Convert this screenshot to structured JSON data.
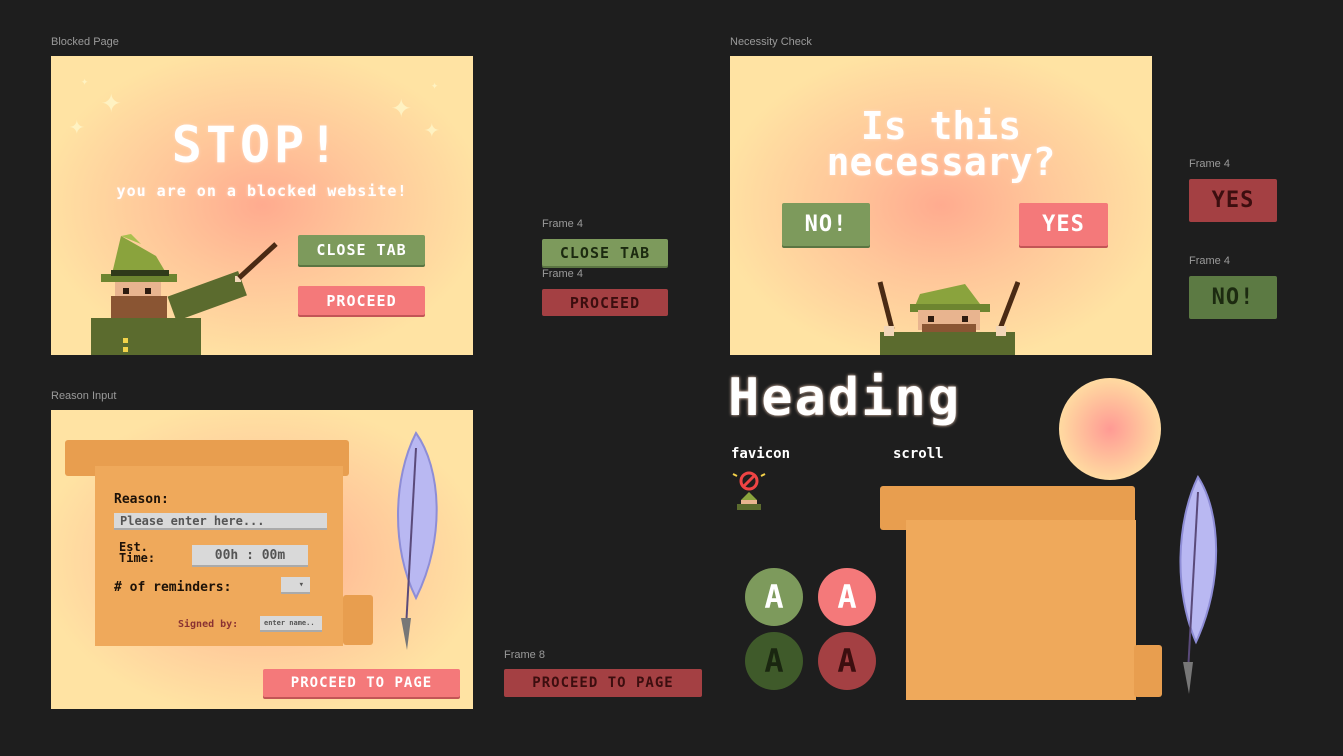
{
  "frames": {
    "blocked": {
      "label": "Blocked Page",
      "title": "STOP!",
      "subtitle": "you are on a blocked website!",
      "close_tab": "CLOSE TAB",
      "proceed": "PROCEED"
    },
    "necessity": {
      "label": "Necessity Check",
      "title_line1": "Is this",
      "title_line2": "necessary?",
      "no": "NO!",
      "yes": "YES"
    },
    "reason": {
      "label": "Reason Input",
      "reason_label": "Reason:",
      "reason_placeholder": "Please enter here...",
      "est_label_1": "Est.",
      "est_label_2": "Time:",
      "time_value": "00h : 00m",
      "reminders_label": "# of reminders:",
      "signed_label": "Signed by:",
      "signed_placeholder": "enter name..",
      "proceed_page": "PROCEED TO PAGE"
    }
  },
  "components": {
    "close_tab": {
      "label": "Frame 4",
      "text": "CLOSE TAB"
    },
    "proceed": {
      "label": "Frame 4",
      "text": "PROCEED"
    },
    "yes": {
      "label": "Frame 4",
      "text": "YES"
    },
    "no": {
      "label": "Frame 4",
      "text": "NO!"
    },
    "proceed_page": {
      "label": "Frame 8",
      "text": "PROCEED TO PAGE"
    }
  },
  "assets": {
    "heading": "Heading",
    "favicon_label": "favicon",
    "scroll_label": "scroll",
    "circle_letter": "A"
  },
  "colors": {
    "background": "#1e1e1e",
    "green": "#7d9a5c",
    "pink": "#f4797a",
    "dark_green": "#5c7a43",
    "dark_red": "#a44043",
    "scroll": "#efa95b",
    "cream": "#ffe3a3"
  }
}
